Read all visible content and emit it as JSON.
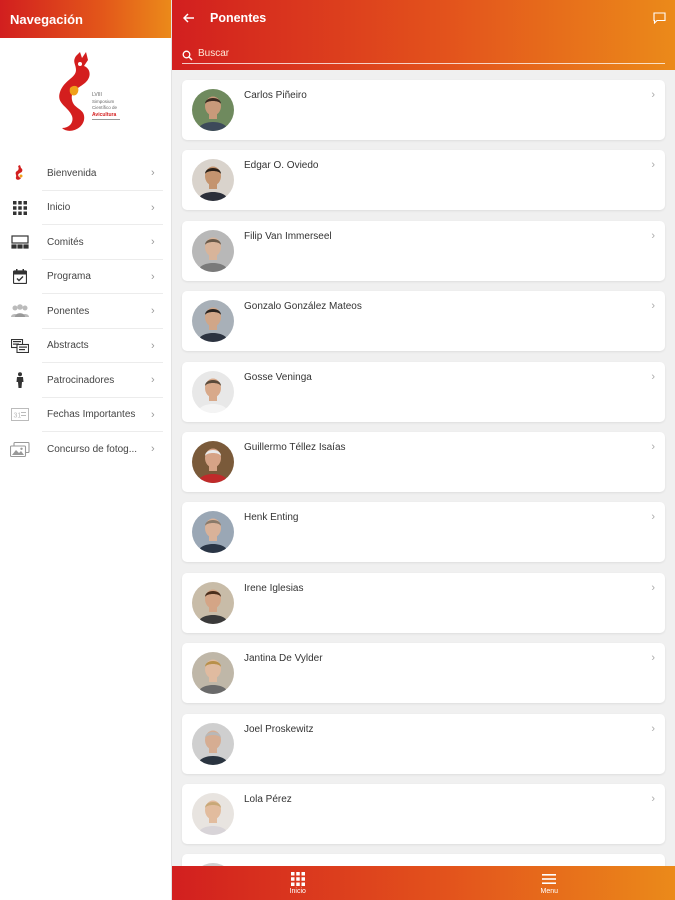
{
  "sidebar": {
    "title": "Navegación",
    "logo_text": [
      "LVIII",
      "Simposium",
      "Científico de",
      "Avicultura"
    ],
    "items": [
      {
        "label": "Bienvenida",
        "icon": "logo-mark-icon"
      },
      {
        "label": "Inicio",
        "icon": "grid-icon"
      },
      {
        "label": "Comités",
        "icon": "org-chart-icon"
      },
      {
        "label": "Programa",
        "icon": "calendar-icon"
      },
      {
        "label": "Ponentes",
        "icon": "people-icon"
      },
      {
        "label": "Abstracts",
        "icon": "documents-icon"
      },
      {
        "label": "Patrocinadores",
        "icon": "person-icon"
      },
      {
        "label": "Fechas Importantes",
        "icon": "calendar-range-icon"
      },
      {
        "label": "Concurso de fotog...",
        "icon": "photos-icon"
      }
    ]
  },
  "header": {
    "title": "Ponentes",
    "back_icon": "arrow-left-icon",
    "chat_icon": "chat-icon"
  },
  "search": {
    "placeholder": "Buscar"
  },
  "speakers": [
    {
      "name": "Carlos Piñeiro",
      "avatar_bg": "#6f8a5e",
      "shirt": "#3d4a5a",
      "skin": "#c89a7a",
      "hair": "#3a2a20"
    },
    {
      "name": "Edgar O. Oviedo",
      "avatar_bg": "#d9d3cc",
      "shirt": "#2b2f3a",
      "skin": "#c4946f",
      "hair": "#2a2018"
    },
    {
      "name": "Filip Van Immerseel",
      "avatar_bg": "#b8b8b8",
      "shirt": "#7a7a7a",
      "skin": "#d8b49a",
      "hair": "#6a5a4a"
    },
    {
      "name": "Gonzalo González Mateos",
      "avatar_bg": "#a8b0b8",
      "shirt": "#2c3340",
      "skin": "#d0a688",
      "hair": "#2a2420"
    },
    {
      "name": "Gosse Veninga",
      "avatar_bg": "#e8e8e8",
      "shirt": "#f4f4f4",
      "skin": "#d8a98a",
      "hair": "#5a4a3a"
    },
    {
      "name": "Guillermo Téllez Isaías",
      "avatar_bg": "#7a5a3a",
      "shirt": "#c02a2a",
      "skin": "#d6a386",
      "hair": "#eaeaea"
    },
    {
      "name": "Henk Enting",
      "avatar_bg": "#9aa7b5",
      "shirt": "#2a3545",
      "skin": "#d9b299",
      "hair": "#8a7a6a"
    },
    {
      "name": "Irene Iglesias",
      "avatar_bg": "#c8bca8",
      "shirt": "#3a3a3a",
      "skin": "#d4a586",
      "hair": "#4a2e1c"
    },
    {
      "name": "Jantina De Vylder",
      "avatar_bg": "#bfb7a8",
      "shirt": "#6a6a6a",
      "skin": "#e0bba0",
      "hair": "#b8904a"
    },
    {
      "name": "Joel Proskewitz",
      "avatar_bg": "#cfcfcf",
      "shirt": "#2a3440",
      "skin": "#d6ad92",
      "hair": "#b8b8b8"
    },
    {
      "name": "Lola Pérez",
      "avatar_bg": "#e8e4e0",
      "shirt": "#d8d4d8",
      "skin": "#e2bc9e",
      "hair": "#c8a878"
    },
    {
      "name": "",
      "avatar_bg": "#d0d0d0",
      "shirt": "#888888",
      "skin": "#d0a888",
      "hair": "#5a4a3a"
    }
  ],
  "bottom_tabs": [
    {
      "label": "Inicio",
      "icon": "grid-icon"
    },
    {
      "label": "Menu",
      "icon": "hamburger-menu-icon"
    }
  ],
  "colors": {
    "brand_red": "#d21f1f",
    "brand_orange": "#eb8a1a"
  }
}
